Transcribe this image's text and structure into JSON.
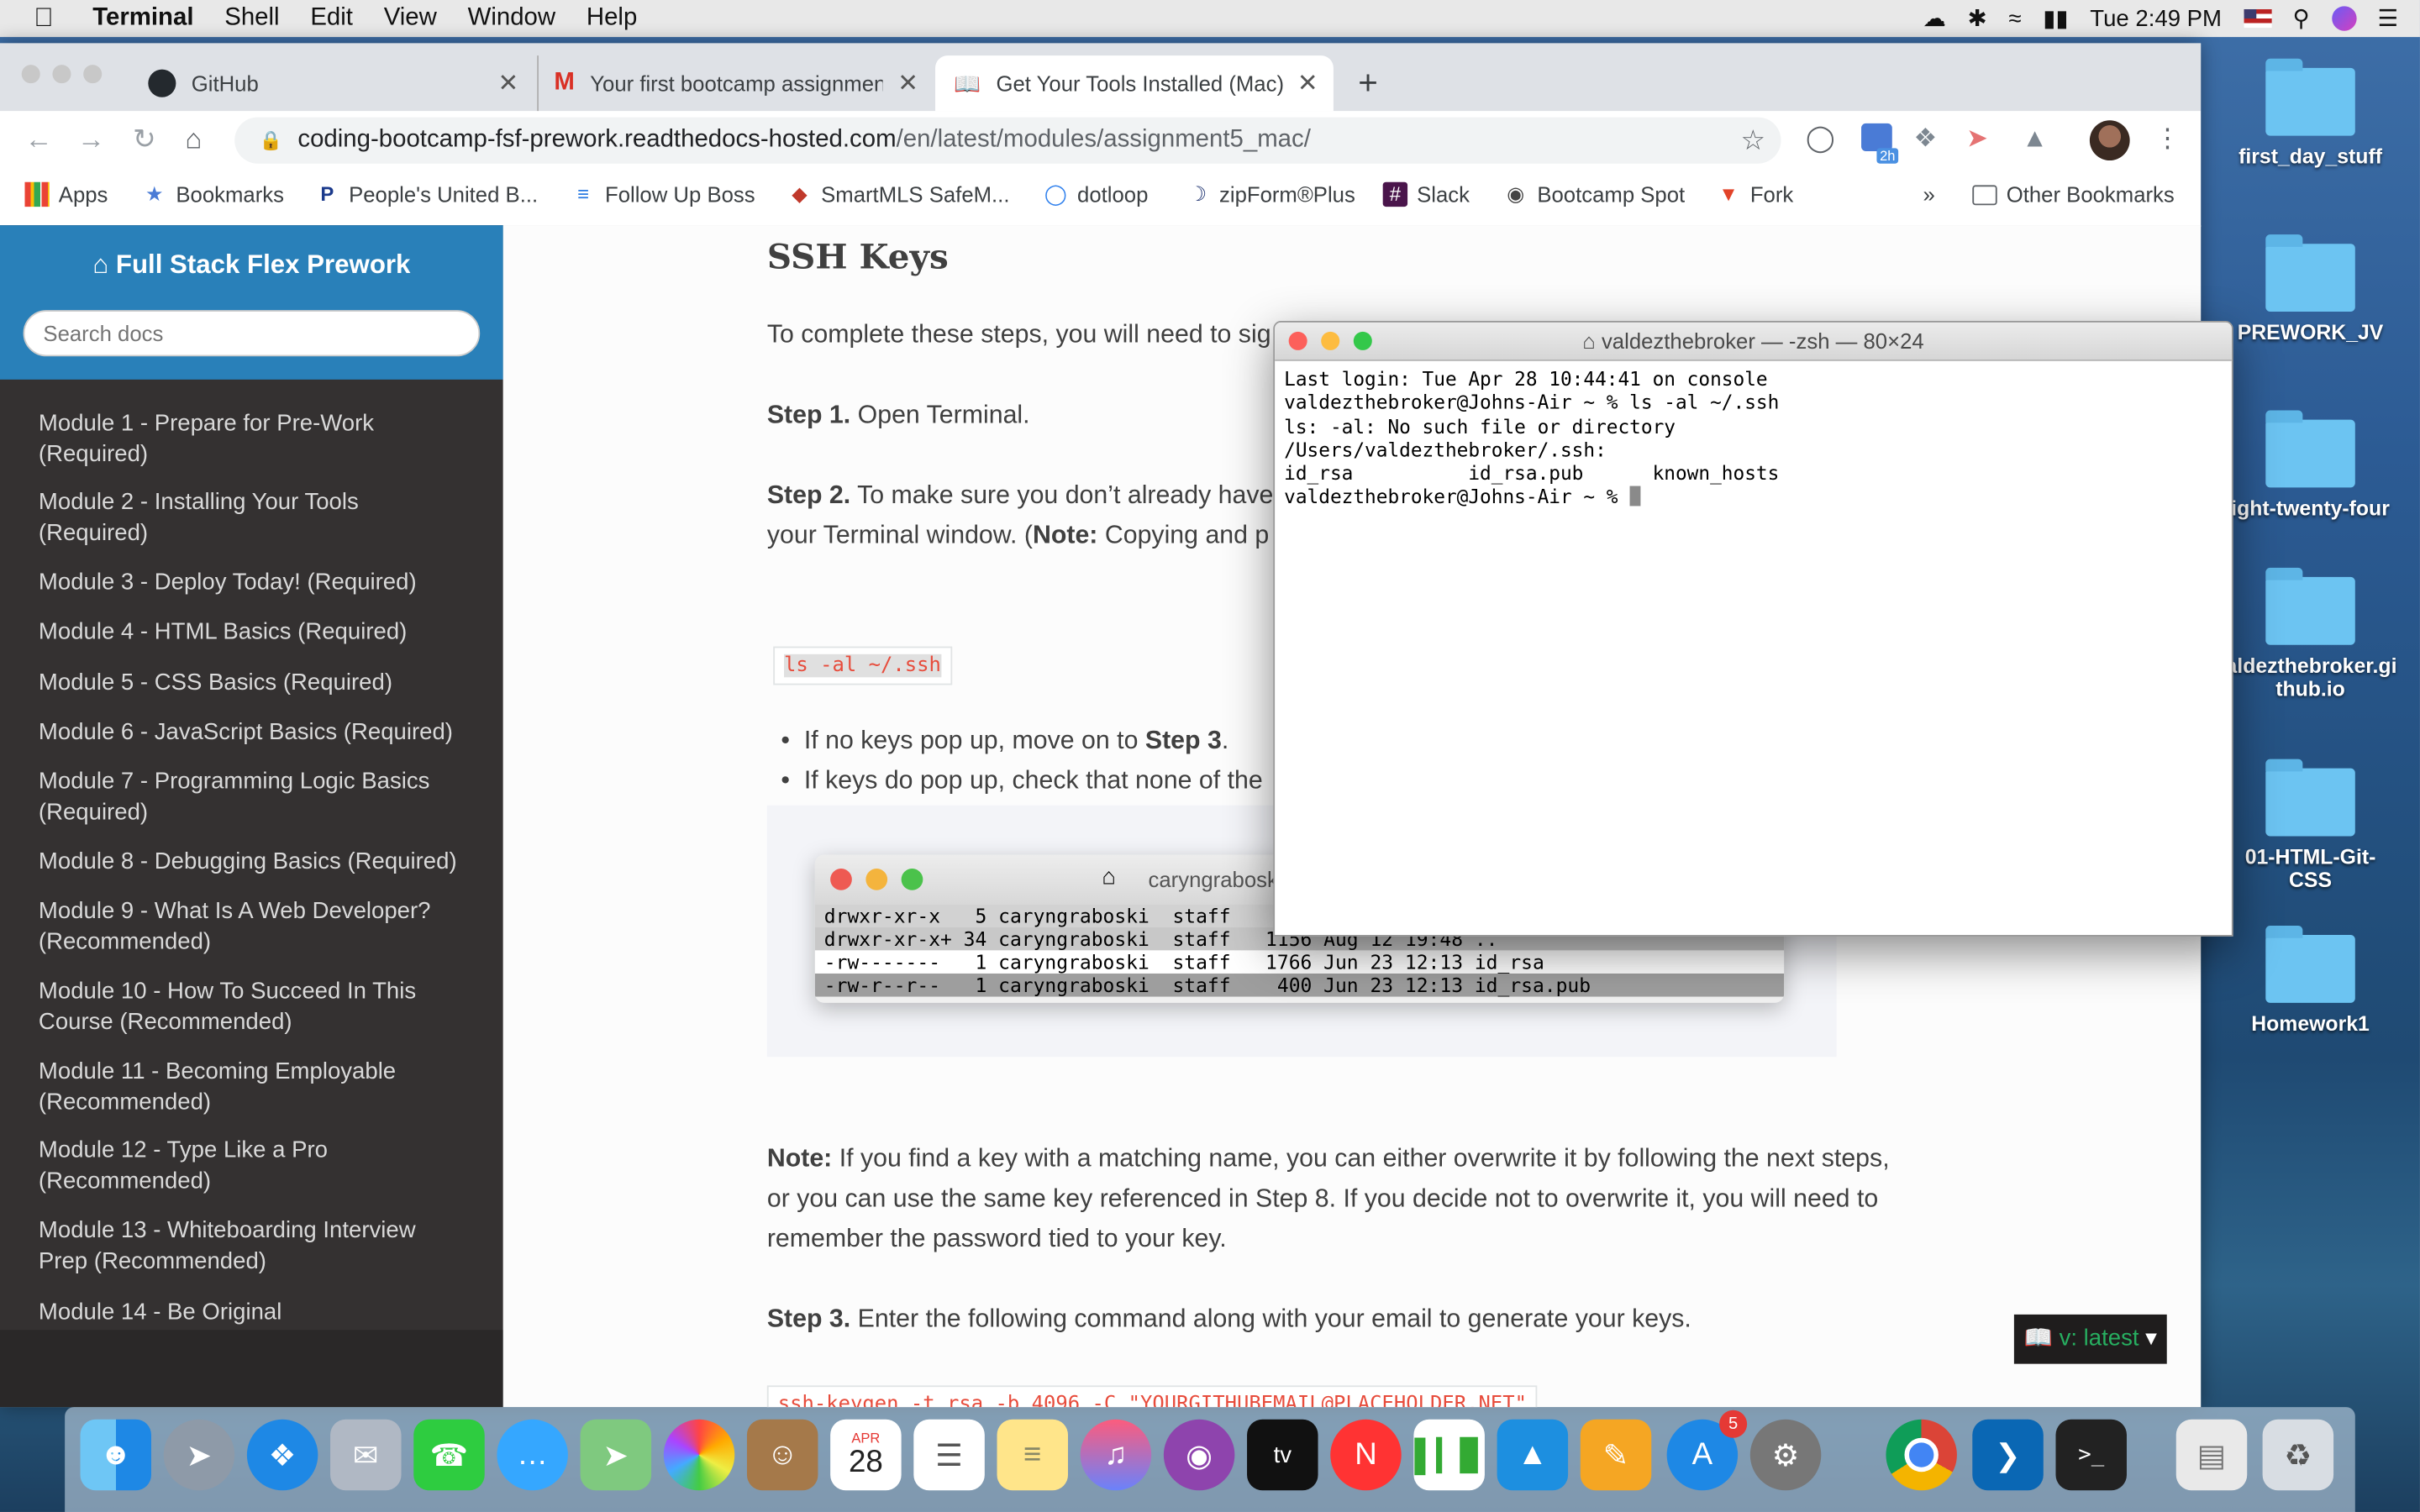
{
  "menubar": {
    "app": "Terminal",
    "items": [
      "Shell",
      "Edit",
      "View",
      "Window",
      "Help"
    ],
    "clock": "Tue 2:49 PM"
  },
  "browser": {
    "tabs": [
      {
        "title": "GitHub"
      },
      {
        "title": "Your first bootcamp assignmen"
      },
      {
        "title": "Get Your Tools Installed (Mac)"
      }
    ],
    "url_host": "coding-bootcamp-fsf-prework.readthedocs-hosted.com",
    "url_path": "/en/latest/modules/assignment5_mac/",
    "ext_badge": "2h",
    "bookmarks": [
      "Apps",
      "Bookmarks",
      "People's United B...",
      "Follow Up Boss",
      "SmartMLS SafeM...",
      "dotloop",
      "zipForm®Plus",
      "Slack",
      "Bootcamp Spot",
      "Fork"
    ],
    "bookmarks_more": "»",
    "other_bookmarks": "Other Bookmarks"
  },
  "sidebar": {
    "title": "Full Stack Flex Prework",
    "search_placeholder": "Search docs",
    "items": [
      {
        "line1": "Module 1 - Prepare for Pre-Work",
        "line2": "(Required)"
      },
      {
        "line1": "Module 2 - Installing Your Tools",
        "line2": "(Required)"
      },
      {
        "line1": "Module 3 - Deploy Today! (Required)",
        "line2": ""
      },
      {
        "line1": "Module 4 - HTML Basics (Required)",
        "line2": ""
      },
      {
        "line1": "Module 5 - CSS Basics (Required)",
        "line2": ""
      },
      {
        "line1": "Module 6 - JavaScript Basics (Required)",
        "line2": ""
      },
      {
        "line1": "Module 7 - Programming Logic Basics",
        "line2": "(Required)"
      },
      {
        "line1": "Module 8 - Debugging Basics (Required)",
        "line2": ""
      },
      {
        "line1": "Module 9 - What Is A Web Developer?",
        "line2": "(Recommended)"
      },
      {
        "line1": "Module 10 - How To Succeed In This",
        "line2": "Course (Recommended)"
      },
      {
        "line1": "Module 11 - Becoming Employable",
        "line2": "(Recommended)"
      },
      {
        "line1": "Module 12 - Type Like a Pro",
        "line2": "(Recommended)"
      },
      {
        "line1": "Module 13 - Whiteboarding Interview",
        "line2": "Prep (Recommended)"
      },
      {
        "line1": "Module 14 - Be Original",
        "line2": ""
      }
    ]
  },
  "content": {
    "heading": "SSH Keys",
    "intro": "To complete these steps, you will need to sig",
    "step1_label": "Step 1.",
    "step1_text": " Open Terminal.",
    "step2_label": "Step 2.",
    "step2_text": " To make sure you don’t already have",
    "step2_line2a": "your Terminal window. (",
    "step2_note": "Note:",
    "step2_line2b": " Copying and p",
    "code1": "ls -al ~/.ssh",
    "bullet1a": "If no keys pop up, move on to ",
    "bullet1b": "Step 3",
    "bullet1c": ".",
    "bullet2": "If keys do pop up, check that none of the",
    "figure_title": "caryngraboski",
    "figure_lines": [
      "drwxr-xr-x   5 caryngraboski  staff",
      "drwxr-xr-x+ 34 caryngraboski  staff   1156 Aug 12 19:48 ..",
      "-rw-------   1 caryngraboski  staff   1766 Jun 23 12:13 id_rsa",
      "-rw-r--r--   1 caryngraboski  staff    400 Jun 23 12:13 id_rsa.pub"
    ],
    "note_label": "Note:",
    "note_line1": " If you find a key with a matching name, you can either overwrite it by following the next steps,",
    "note_line2": "or you can use the same key referenced in Step 8. If you decide not to overwrite it, you will need to",
    "note_line3": "remember the password tied to your key.",
    "step3_label": "Step 3.",
    "step3_text": " Enter the following command along with your email to generate your keys.",
    "code2": "ssh-keygen -t rsa -b 4096 -C \"YOURGITHUBEMAIL@PLACEHOLDER.NET\"",
    "version_label": "v: latest"
  },
  "terminal": {
    "title": "valdezthebroker — -zsh — 80×24",
    "lines": [
      "Last login: Tue Apr 28 10:44:41 on console",
      "valdezthebroker@Johns-Air ~ % ls -al ~/.ssh",
      "ls: -al: No such file or directory",
      "/Users/valdezthebroker/.ssh:",
      "id_rsa          id_rsa.pub      known_hosts"
    ],
    "prompt": "valdezthebroker@Johns-Air ~ % "
  },
  "desktop": {
    "icons": [
      "first_day_stuff",
      "PREWORK_JV",
      "ight-twenty-four",
      "aldezthebroker.gi",
      "thub.io",
      "01-HTML-Git-CSS",
      "Homework1"
    ]
  },
  "dock": {
    "calendar_month": "APR",
    "calendar_day": "28",
    "appstore_badge": "5",
    "tv_label": "tv"
  }
}
